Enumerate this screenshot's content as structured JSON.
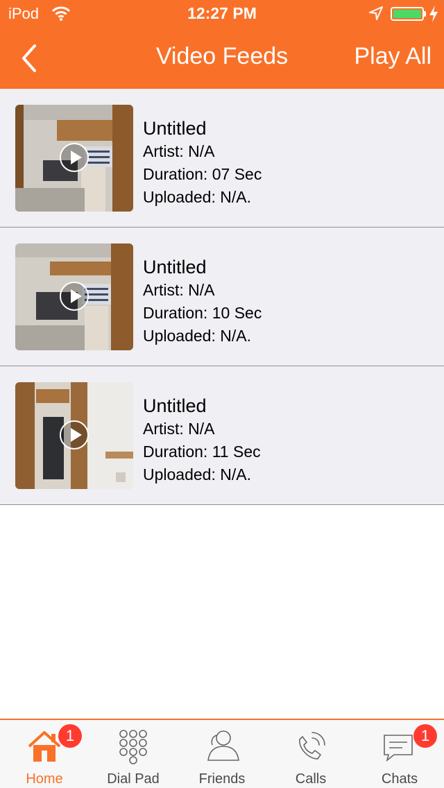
{
  "status_bar": {
    "carrier": "iPod",
    "time": "12:27 PM",
    "battery_color": "#4cd964"
  },
  "nav": {
    "title": "Video Feeds",
    "play_all_label": "Play All",
    "back_icon": "chevron-left-icon"
  },
  "theme": {
    "accent": "#f97128",
    "badge": "#ff3b30",
    "list_background": "#efeff4"
  },
  "videos": [
    {
      "title": "Untitled",
      "artist": "Artist: N/A",
      "duration": "Duration: 07 Sec",
      "uploaded": "Uploaded: N/A."
    },
    {
      "title": "Untitled",
      "artist": "Artist: N/A",
      "duration": "Duration: 10 Sec",
      "uploaded": "Uploaded: N/A."
    },
    {
      "title": "Untitled",
      "artist": "Artist: N/A",
      "duration": "Duration: 11 Sec",
      "uploaded": "Uploaded: N/A."
    }
  ],
  "tabs": [
    {
      "label": "Home",
      "icon": "home-icon",
      "active": true,
      "badge": "1"
    },
    {
      "label": "Dial Pad",
      "icon": "dialpad-icon",
      "active": false
    },
    {
      "label": "Friends",
      "icon": "friends-icon",
      "active": false
    },
    {
      "label": "Calls",
      "icon": "phone-icon",
      "active": false
    },
    {
      "label": "Chats",
      "icon": "chat-icon",
      "active": false,
      "badge": "1"
    }
  ]
}
